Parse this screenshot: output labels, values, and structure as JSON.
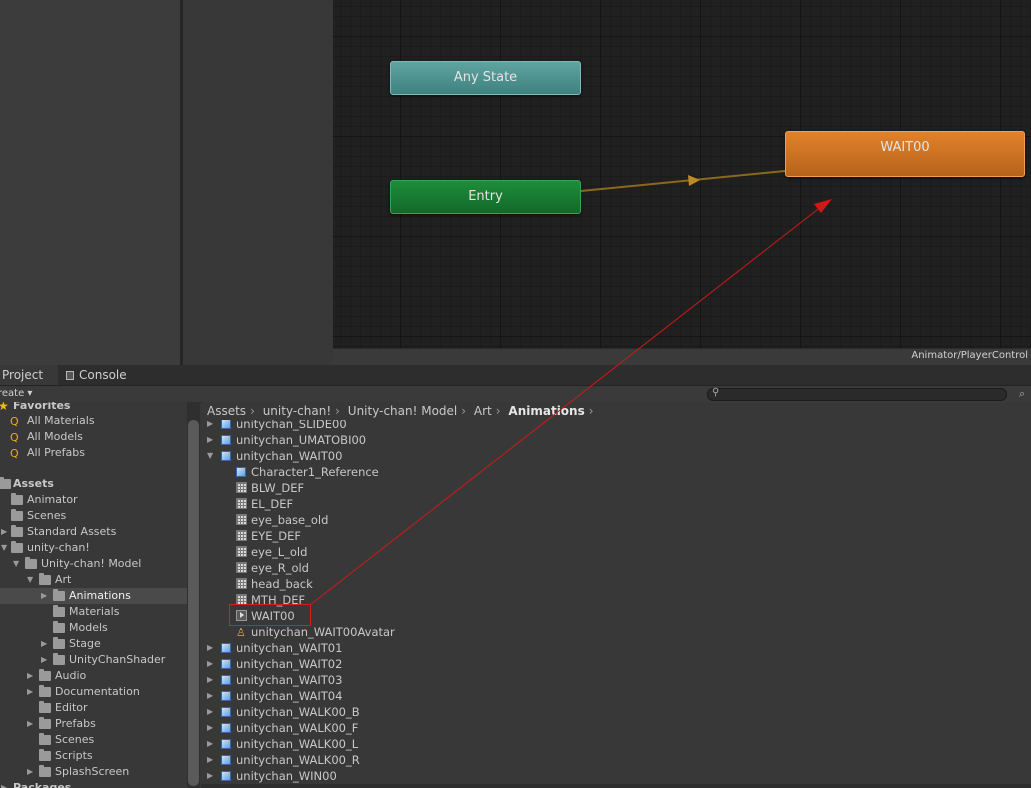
{
  "animator": {
    "states": {
      "any_state": "Any State",
      "entry": "Entry",
      "wait": "WAIT00"
    },
    "path": "Animator/PlayerControl"
  },
  "tabs": {
    "project": "Project",
    "console": "Console"
  },
  "toolbar": {
    "create": "reate ▾"
  },
  "tree": {
    "favorites": "Favorites",
    "fav_items": [
      "All Materials",
      "All Models",
      "All Prefabs"
    ],
    "assets": "Assets",
    "items": [
      "Animator",
      "Scenes",
      "Standard Assets",
      "unity-chan!",
      "Unity-chan! Model",
      "Art",
      "Animations",
      "Materials",
      "Models",
      "Stage",
      "UnityChanShader",
      "Audio",
      "Documentation",
      "Editor",
      "Prefabs",
      "Scenes",
      "Scripts",
      "SplashScreen"
    ],
    "packages": "Packages"
  },
  "breadcrumb": [
    "Assets",
    "unity-chan!",
    "Unity-chan! Model",
    "Art",
    "Animations"
  ],
  "files": [
    "unitychan_SLIDE00",
    "unitychan_UMATOBI00",
    "unitychan_WAIT00",
    "Character1_Reference",
    "BLW_DEF",
    "EL_DEF",
    "eye_base_old",
    "EYE_DEF",
    "eye_L_old",
    "eye_R_old",
    "head_back",
    "MTH_DEF",
    "WAIT00",
    "unitychan_WAIT00Avatar",
    "unitychan_WAIT01",
    "unitychan_WAIT02",
    "unitychan_WAIT03",
    "unitychan_WAIT04",
    "unitychan_WALK00_B",
    "unitychan_WALK00_F",
    "unitychan_WALK00_L",
    "unitychan_WALK00_R",
    "unitychan_WIN00"
  ],
  "colors": {
    "annotation_red": "#d01818",
    "transition": "#8a6a1a"
  }
}
